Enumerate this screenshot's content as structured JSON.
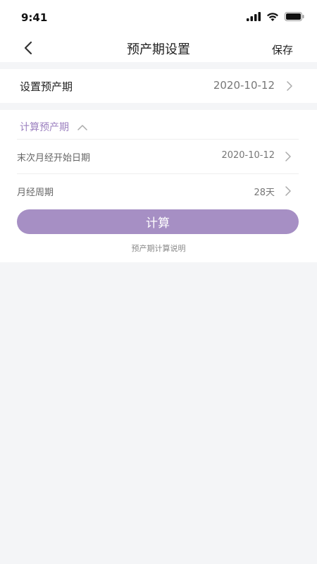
{
  "status_bar": {
    "time": "9:41"
  },
  "nav": {
    "title": "预产期设置",
    "save_label": "保存"
  },
  "due_date_row": {
    "label": "设置预产期",
    "value": "2020-10-12"
  },
  "calculate_section": {
    "title": "计算预产期",
    "rows": [
      {
        "label": "末次月经开始日期",
        "value": "2020-10-12"
      },
      {
        "label": "月经周期",
        "value": "28天"
      }
    ],
    "button_label": "计算",
    "explain_link": "预产期计算说明"
  },
  "colors": {
    "accent": "#a68fc4",
    "accent_text": "#9d82c0",
    "background": "#f4f5f7"
  },
  "icons": [
    "cellular-signal-icon",
    "wifi-icon",
    "battery-icon",
    "back-arrow-icon",
    "chevron-right-icon",
    "chevron-up-icon"
  ]
}
